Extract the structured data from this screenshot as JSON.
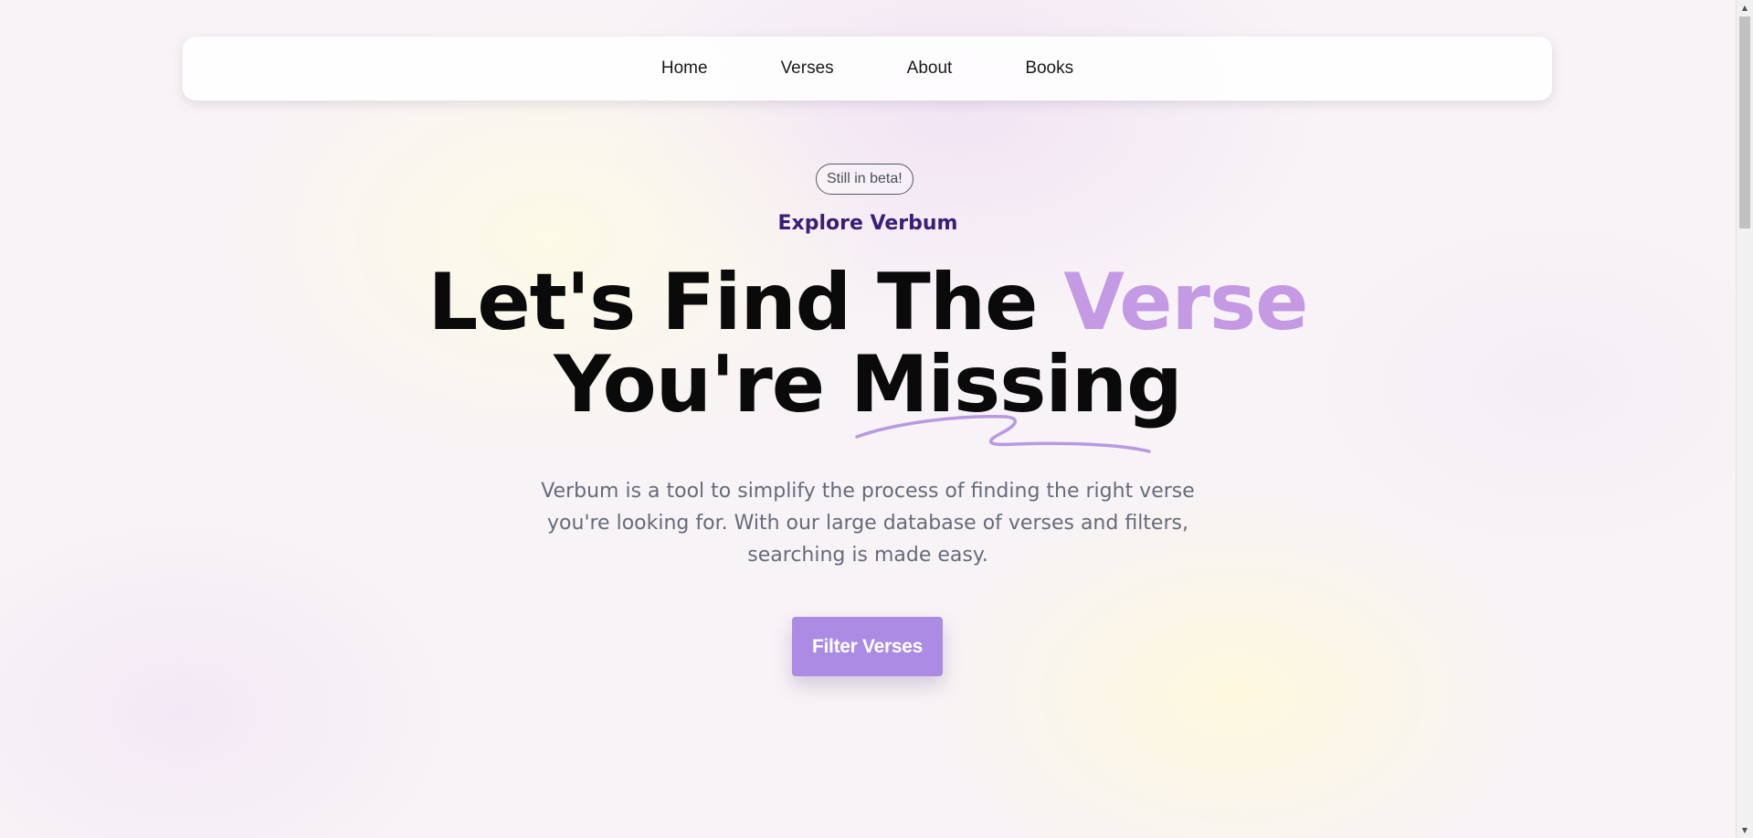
{
  "nav": {
    "items": [
      {
        "label": "Home"
      },
      {
        "label": "Verses"
      },
      {
        "label": "About"
      },
      {
        "label": "Books"
      }
    ]
  },
  "hero": {
    "badge": "Still in beta!",
    "eyebrow": "Explore Verbum",
    "headline": {
      "part1": "Let's Find The ",
      "accent": "Verse",
      "part2": "You're ",
      "underlined": "Missing"
    },
    "description": "Verbum is a tool to simplify the process of finding the right verse you're looking for. With our large database of verses and filters, searching is made easy.",
    "cta_label": "Filter Verses"
  },
  "scrollbar": {
    "up_icon": "triangle-up",
    "down_icon": "triangle-down"
  },
  "colors": {
    "accent": "#c39ae3",
    "button": "#ab8be4",
    "eyebrow": "#3a1e78",
    "description": "#666b7a"
  }
}
